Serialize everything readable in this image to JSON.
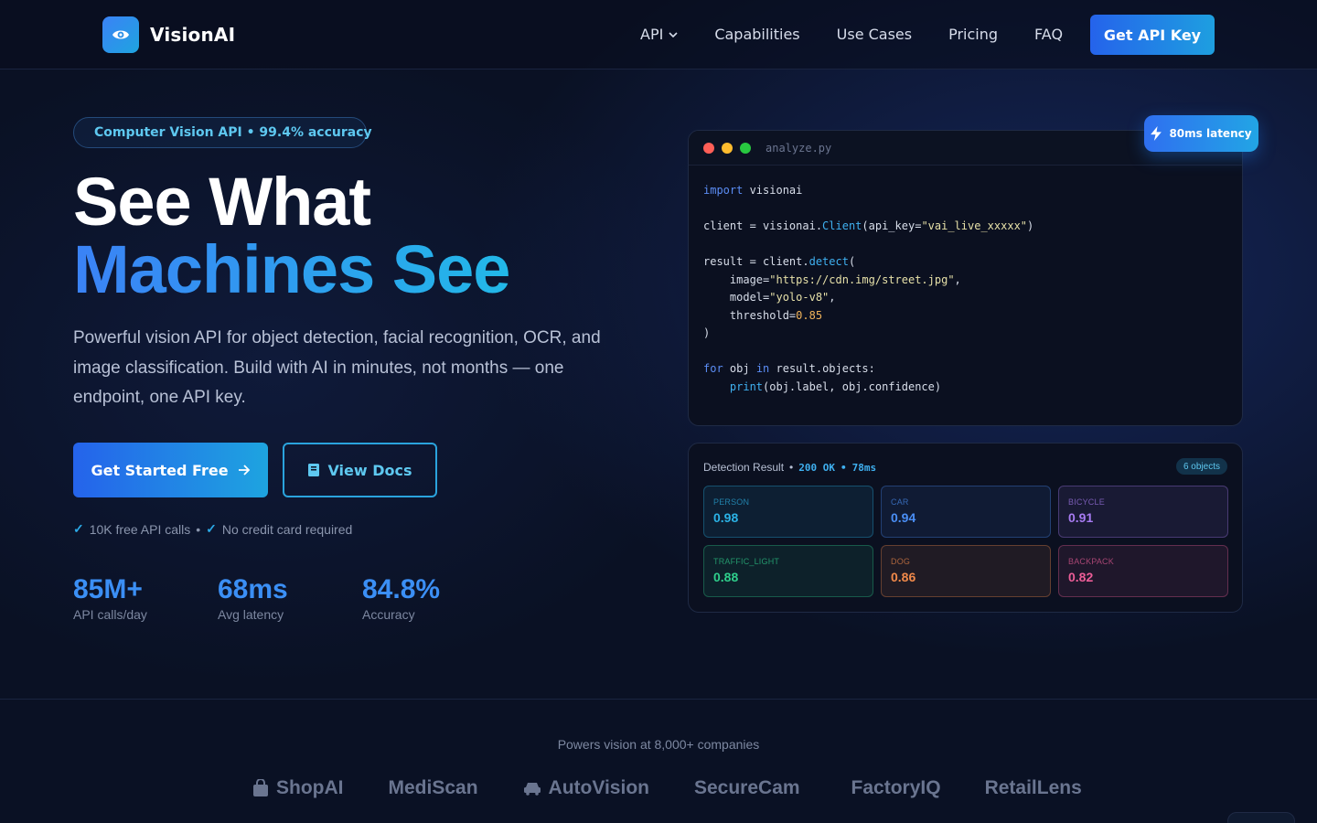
{
  "nav": {
    "brand": "VisionAI",
    "links": [
      "API",
      "Capabilities",
      "Use Cases",
      "Pricing",
      "FAQ"
    ],
    "cta": "Get API Key"
  },
  "hero": {
    "badge": "Computer Vision API • 99.4% accuracy",
    "title_line1": "See What",
    "title_line2": "Machines See",
    "lede": "Powerful vision API for object detection, facial recognition, OCR, and image classification. Build with AI in minutes, not months — one endpoint, one API key.",
    "cta_primary": "Get Started Free",
    "cta_secondary": "View Docs",
    "check1": "10K free API calls",
    "check_sep": "•",
    "check2": "No credit card required",
    "stats": [
      {
        "value": "85M+",
        "label": "API calls/day"
      },
      {
        "value": "68ms",
        "label": "Avg latency"
      },
      {
        "value": "84.8%",
        "label": "Accuracy"
      }
    ]
  },
  "code": {
    "filename": "analyze.py",
    "latency_badge": "80ms latency",
    "dot_colors": [
      "#ff5f57",
      "#febc2e",
      "#28c840"
    ]
  },
  "detection": {
    "title": "Detection Result",
    "sep": "•",
    "status": "200 OK",
    "time": "78ms",
    "count": "6 objects",
    "objects": [
      {
        "label": "PERSON",
        "score": "0.98",
        "color": "#2bb3e6"
      },
      {
        "label": "CAR",
        "score": "0.94",
        "color": "#4a8ef5"
      },
      {
        "label": "BICYCLE",
        "score": "0.91",
        "color": "#a77bf2"
      },
      {
        "label": "TRAFFIC_LIGHT",
        "score": "0.88",
        "color": "#2fcf8c"
      },
      {
        "label": "DOG",
        "score": "0.86",
        "color": "#f0894a"
      },
      {
        "label": "BACKPACK",
        "score": "0.82",
        "color": "#ec5d97"
      }
    ]
  },
  "companies": {
    "caption": "Powers vision at 8,000+ companies",
    "names": [
      "ShopAI",
      "MediScan",
      "AutoVision",
      "SecureCam",
      "FactoryIQ",
      "RetailLens"
    ]
  },
  "colors": {
    "accent": "#2563eb",
    "accent2": "#1ea4e0",
    "background": "#0a1124"
  }
}
